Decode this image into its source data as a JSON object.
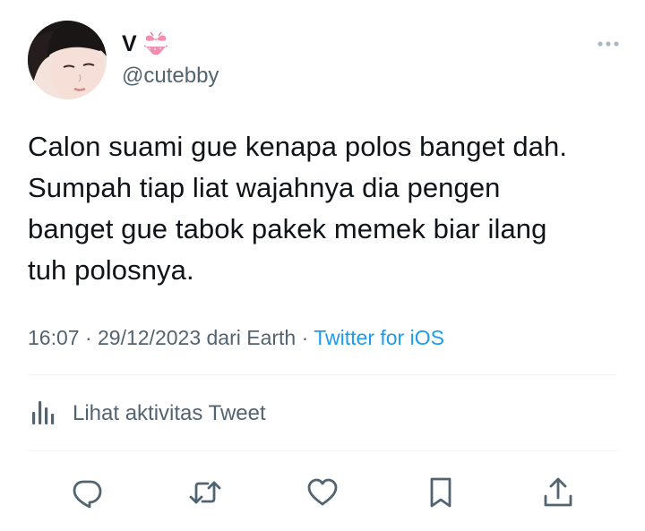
{
  "user": {
    "display_name": "V",
    "emoji_icon": "bikini-icon",
    "handle": "@cutebby"
  },
  "tweet": {
    "text": "Calon suami gue kenapa polos banget dah.\nSumpah tiap liat wajahnya dia pengen\nbanget gue tabok pakek memek biar ilang\ntuh polosnya.",
    "timestamp": "16:07 · 29/12/2023 dari Earth",
    "separator": " · ",
    "source": "Twitter for iOS"
  },
  "activity": {
    "label": "Lihat aktivitas Tweet",
    "icon": "analytics-icon"
  },
  "actions": {
    "reply_icon": "reply-icon",
    "retweet_icon": "retweet-icon",
    "like_icon": "heart-icon",
    "bookmark_icon": "bookmark-icon",
    "share_icon": "share-icon"
  },
  "colors": {
    "text": "#0f1419",
    "secondary": "#536471",
    "accent": "#1d9bf0",
    "divider": "#eff3f4"
  }
}
